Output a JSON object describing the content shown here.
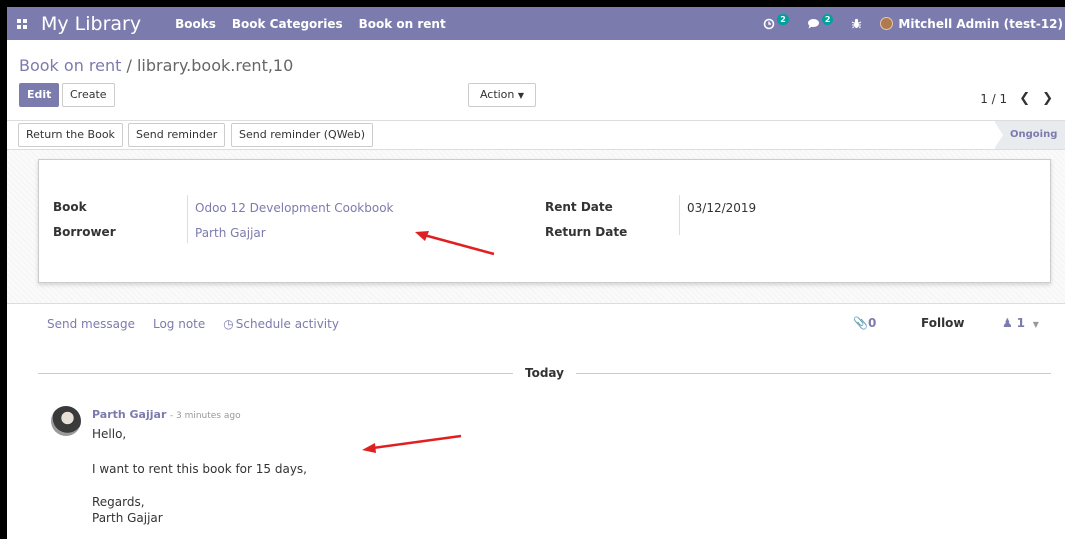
{
  "navbar": {
    "app_name": "My Library",
    "menu": [
      "Books",
      "Book Categories",
      "Book on rent"
    ],
    "activity_badge": "2",
    "messages_badge": "2",
    "user": "Mitchell Admin (test-12)"
  },
  "breadcrumb": {
    "parent": "Book on rent",
    "separator": "/",
    "current": "library.book.rent,10"
  },
  "buttons": {
    "edit": "Edit",
    "create": "Create",
    "action": "Action",
    "return_book": "Return the Book",
    "send_reminder": "Send reminder",
    "send_reminder_qweb": "Send reminder (QWeb)"
  },
  "pager": {
    "value": "1 / 1"
  },
  "status": {
    "stage": "Ongoing"
  },
  "form": {
    "book_label": "Book",
    "book_value": "Odoo 12 Development Cookbook",
    "borrower_label": "Borrower",
    "borrower_value": "Parth Gajjar",
    "rent_date_label": "Rent Date",
    "rent_date_value": "03/12/2019",
    "return_date_label": "Return Date",
    "return_date_value": ""
  },
  "chatter": {
    "send_message": "Send message",
    "log_note": "Log note",
    "schedule_activity": "Schedule activity",
    "attachments_count": "0",
    "follow": "Follow",
    "followers_count": "1",
    "day": "Today",
    "message": {
      "author": "Parth Gajjar",
      "time": "3 minutes ago",
      "lines": [
        "Hello,",
        "I want to rent this book for 15 days,",
        "Regards,",
        "Parth Gajjar"
      ]
    }
  },
  "colors": {
    "primary": "#7c7bad",
    "annotation_arrow": "#e02020",
    "badge": "#00a09d"
  },
  "icons": [
    "apps-icon",
    "activity-icon",
    "chat-icon",
    "bug-icon",
    "paperclip-icon",
    "user-icon",
    "clock-icon",
    "caret-down-icon",
    "chevron-left-icon",
    "chevron-right-icon"
  ]
}
